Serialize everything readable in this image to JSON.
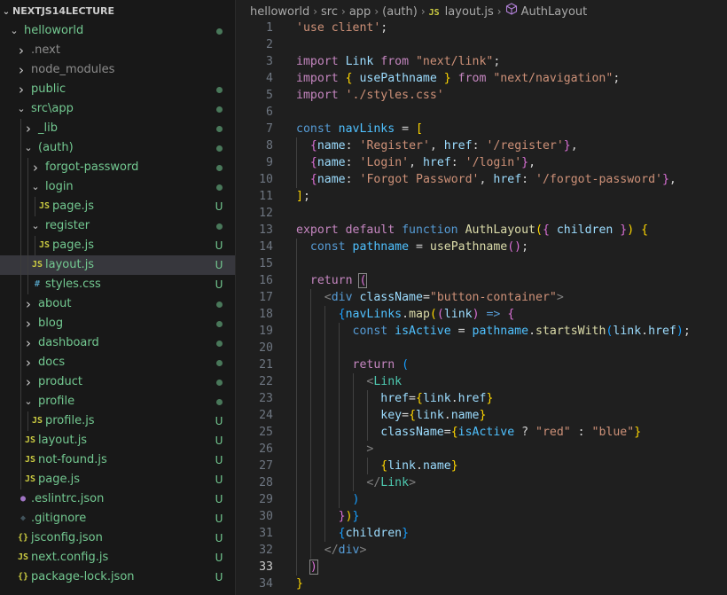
{
  "explorer": {
    "title": "NEXTJS14LECTURE",
    "items": [
      {
        "label": "helloworld",
        "type": "folder",
        "open": true,
        "depth": 0,
        "status": "dot",
        "color": "#73c991"
      },
      {
        "label": ".next",
        "type": "folder",
        "open": false,
        "depth": 1,
        "status": "",
        "color": "#8c8c8c"
      },
      {
        "label": "node_modules",
        "type": "folder",
        "open": false,
        "depth": 1,
        "status": "",
        "color": "#8c8c8c"
      },
      {
        "label": "public",
        "type": "folder",
        "open": false,
        "depth": 1,
        "status": "dot",
        "color": "#73c991"
      },
      {
        "label": "src\\app",
        "type": "folder",
        "open": true,
        "depth": 1,
        "status": "dot",
        "color": "#73c991"
      },
      {
        "label": "_lib",
        "type": "folder",
        "open": false,
        "depth": 2,
        "status": "dot",
        "color": "#73c991"
      },
      {
        "label": "(auth)",
        "type": "folder",
        "open": true,
        "depth": 2,
        "status": "dot",
        "color": "#73c991"
      },
      {
        "label": "forgot-password",
        "type": "folder",
        "open": false,
        "depth": 3,
        "status": "dot",
        "color": "#73c991"
      },
      {
        "label": "login",
        "type": "folder",
        "open": true,
        "depth": 3,
        "status": "dot",
        "color": "#73c991"
      },
      {
        "label": "page.js",
        "type": "js",
        "depth": 4,
        "status": "U",
        "color": "#73c991"
      },
      {
        "label": "register",
        "type": "folder",
        "open": true,
        "depth": 3,
        "status": "dot",
        "color": "#73c991"
      },
      {
        "label": "page.js",
        "type": "js",
        "depth": 4,
        "status": "U",
        "color": "#73c991"
      },
      {
        "label": "layout.js",
        "type": "js",
        "depth": 3,
        "status": "U",
        "color": "#73c991",
        "selected": true
      },
      {
        "label": "styles.css",
        "type": "css",
        "depth": 3,
        "status": "U",
        "color": "#73c991"
      },
      {
        "label": "about",
        "type": "folder",
        "open": false,
        "depth": 2,
        "status": "dot",
        "color": "#73c991"
      },
      {
        "label": "blog",
        "type": "folder",
        "open": false,
        "depth": 2,
        "status": "dot",
        "color": "#73c991"
      },
      {
        "label": "dashboard",
        "type": "folder",
        "open": false,
        "depth": 2,
        "status": "dot",
        "color": "#73c991"
      },
      {
        "label": "docs",
        "type": "folder",
        "open": false,
        "depth": 2,
        "status": "dot",
        "color": "#73c991"
      },
      {
        "label": "product",
        "type": "folder",
        "open": false,
        "depth": 2,
        "status": "dot",
        "color": "#73c991"
      },
      {
        "label": "profile",
        "type": "folder",
        "open": true,
        "depth": 2,
        "status": "dot",
        "color": "#73c991"
      },
      {
        "label": "profile.js",
        "type": "js",
        "depth": 3,
        "status": "U",
        "color": "#73c991"
      },
      {
        "label": "layout.js",
        "type": "js",
        "depth": 2,
        "status": "U",
        "color": "#73c991"
      },
      {
        "label": "not-found.js",
        "type": "js",
        "depth": 2,
        "status": "U",
        "color": "#73c991"
      },
      {
        "label": "page.js",
        "type": "js",
        "depth": 2,
        "status": "U",
        "color": "#73c991"
      },
      {
        "label": ".eslintrc.json",
        "type": "eslint",
        "depth": 1,
        "status": "U",
        "color": "#73c991"
      },
      {
        "label": ".gitignore",
        "type": "git",
        "depth": 1,
        "status": "U",
        "color": "#73c991"
      },
      {
        "label": "jsconfig.json",
        "type": "json",
        "depth": 1,
        "status": "U",
        "color": "#73c991"
      },
      {
        "label": "next.config.js",
        "type": "js",
        "depth": 1,
        "status": "U",
        "color": "#73c991"
      },
      {
        "label": "package-lock.json",
        "type": "json",
        "depth": 1,
        "status": "U",
        "color": "#73c991"
      }
    ],
    "icon_glyphs": {
      "js": "JS",
      "css": "#",
      "json": "{}",
      "git": "◆",
      "eslint": "●"
    },
    "icon_colors": {
      "js": "#cbcb41",
      "css": "#519aba",
      "json": "#cbcb41",
      "git": "#41535b",
      "eslint": "#a074c4"
    }
  },
  "breadcrumb": {
    "parts": [
      "helloworld",
      "src",
      "app",
      "(auth)"
    ],
    "file_badge": "JS",
    "file": "layout.js",
    "symbol_icon": "cube-icon",
    "symbol": "AuthLayout"
  },
  "editor": {
    "current_line": 33,
    "colors": {
      "str": "#ce9178",
      "kw": "#569cd6",
      "ctl": "#c586c0",
      "fn": "#dcdcaa",
      "var": "#9cdcfe",
      "var2": "#4fc1ff",
      "tag": "#4ec9b0",
      "plain": "#d4d4d4",
      "attr": "#9cdcfe",
      "br1": "#ffd700",
      "br2": "#da70d6",
      "br3": "#179fff",
      "punc": "#d4d4d4",
      "jsxtag": "#808080",
      "tagname": "#569cd6"
    },
    "lines": [
      {
        "n": "1",
        "i": 0,
        "t": [
          [
            "str",
            "'use client'"
          ],
          [
            "plain",
            ";"
          ]
        ]
      },
      {
        "n": "2",
        "i": 0,
        "t": []
      },
      {
        "n": "3",
        "i": 0,
        "t": [
          [
            "ctl",
            "import "
          ],
          [
            "var",
            "Link "
          ],
          [
            "ctl",
            "from "
          ],
          [
            "str",
            "\"next/link\""
          ],
          [
            "plain",
            ";"
          ]
        ]
      },
      {
        "n": "4",
        "i": 0,
        "t": [
          [
            "ctl",
            "import "
          ],
          [
            "br1",
            "{ "
          ],
          [
            "var",
            "usePathname "
          ],
          [
            "br1",
            "} "
          ],
          [
            "ctl",
            "from "
          ],
          [
            "str",
            "\"next/navigation\""
          ],
          [
            "plain",
            ";"
          ]
        ]
      },
      {
        "n": "5",
        "i": 0,
        "t": [
          [
            "ctl",
            "import "
          ],
          [
            "str",
            "'./styles.css'"
          ]
        ]
      },
      {
        "n": "6",
        "i": 0,
        "t": []
      },
      {
        "n": "7",
        "i": 0,
        "t": [
          [
            "kw",
            "const "
          ],
          [
            "var2",
            "navLinks "
          ],
          [
            "plain",
            "= "
          ],
          [
            "br1",
            "["
          ]
        ]
      },
      {
        "n": "8",
        "i": 1,
        "t": [
          [
            "plain",
            "  "
          ],
          [
            "br2",
            "{"
          ],
          [
            "var",
            "name"
          ],
          [
            "plain",
            ": "
          ],
          [
            "str",
            "'Register'"
          ],
          [
            "plain",
            ", "
          ],
          [
            "var",
            "href"
          ],
          [
            "plain",
            ": "
          ],
          [
            "str",
            "'/register'"
          ],
          [
            "br2",
            "}"
          ],
          [
            "plain",
            ","
          ]
        ]
      },
      {
        "n": "9",
        "i": 1,
        "t": [
          [
            "plain",
            "  "
          ],
          [
            "br2",
            "{"
          ],
          [
            "var",
            "name"
          ],
          [
            "plain",
            ": "
          ],
          [
            "str",
            "'Login'"
          ],
          [
            "plain",
            ", "
          ],
          [
            "var",
            "href"
          ],
          [
            "plain",
            ": "
          ],
          [
            "str",
            "'/login'"
          ],
          [
            "br2",
            "}"
          ],
          [
            "plain",
            ","
          ]
        ]
      },
      {
        "n": "10",
        "i": 1,
        "t": [
          [
            "plain",
            "  "
          ],
          [
            "br2",
            "{"
          ],
          [
            "var",
            "name"
          ],
          [
            "plain",
            ": "
          ],
          [
            "str",
            "'Forgot Password'"
          ],
          [
            "plain",
            ", "
          ],
          [
            "var",
            "href"
          ],
          [
            "plain",
            ": "
          ],
          [
            "str",
            "'/forgot-password'"
          ],
          [
            "br2",
            "}"
          ],
          [
            "plain",
            ","
          ]
        ]
      },
      {
        "n": "11",
        "i": 0,
        "t": [
          [
            "br1",
            "]"
          ],
          [
            "plain",
            ";"
          ]
        ]
      },
      {
        "n": "12",
        "i": 0,
        "t": []
      },
      {
        "n": "13",
        "i": 0,
        "t": [
          [
            "ctl",
            "export "
          ],
          [
            "ctl",
            "default "
          ],
          [
            "kw",
            "function "
          ],
          [
            "fn",
            "AuthLayout"
          ],
          [
            "br1",
            "("
          ],
          [
            "br2",
            "{ "
          ],
          [
            "var",
            "children "
          ],
          [
            "br2",
            "}"
          ],
          [
            "br1",
            ") "
          ],
          [
            "br1",
            "{"
          ]
        ]
      },
      {
        "n": "14",
        "i": 1,
        "t": [
          [
            "plain",
            "  "
          ],
          [
            "kw",
            "const "
          ],
          [
            "var2",
            "pathname "
          ],
          [
            "plain",
            "= "
          ],
          [
            "fn",
            "usePathname"
          ],
          [
            "br2",
            "()"
          ],
          [
            "plain",
            ";"
          ]
        ]
      },
      {
        "n": "15",
        "i": 1,
        "t": []
      },
      {
        "n": "16",
        "i": 1,
        "t": [
          [
            "plain",
            "  "
          ],
          [
            "ctl",
            "return "
          ],
          [
            "br2",
            "("
          ]
        ]
      },
      {
        "n": "17",
        "i": 2,
        "t": [
          [
            "plain",
            "    "
          ],
          [
            "jsxtag",
            "<"
          ],
          [
            "tagname",
            "div "
          ],
          [
            "attr",
            "className"
          ],
          [
            "plain",
            "="
          ],
          [
            "str",
            "\"button-container\""
          ],
          [
            "jsxtag",
            ">"
          ]
        ]
      },
      {
        "n": "18",
        "i": 3,
        "t": [
          [
            "plain",
            "      "
          ],
          [
            "br3",
            "{"
          ],
          [
            "var2",
            "navLinks"
          ],
          [
            "plain",
            "."
          ],
          [
            "fn",
            "map"
          ],
          [
            "br1",
            "("
          ],
          [
            "br2",
            "("
          ],
          [
            "var",
            "link"
          ],
          [
            "br2",
            ")"
          ],
          [
            "plain",
            " "
          ],
          [
            "kw",
            "=>"
          ],
          [
            "plain",
            " "
          ],
          [
            "br2",
            "{"
          ]
        ]
      },
      {
        "n": "19",
        "i": 4,
        "t": [
          [
            "plain",
            "        "
          ],
          [
            "kw",
            "const "
          ],
          [
            "var2",
            "isActive "
          ],
          [
            "plain",
            "= "
          ],
          [
            "var2",
            "pathname"
          ],
          [
            "plain",
            "."
          ],
          [
            "fn",
            "startsWith"
          ],
          [
            "br3",
            "("
          ],
          [
            "var",
            "link"
          ],
          [
            "plain",
            "."
          ],
          [
            "var",
            "href"
          ],
          [
            "br3",
            ")"
          ],
          [
            "plain",
            ";"
          ]
        ]
      },
      {
        "n": "20",
        "i": 4,
        "t": []
      },
      {
        "n": "21",
        "i": 4,
        "t": [
          [
            "plain",
            "        "
          ],
          [
            "ctl",
            "return "
          ],
          [
            "br3",
            "("
          ]
        ]
      },
      {
        "n": "22",
        "i": 5,
        "t": [
          [
            "plain",
            "          "
          ],
          [
            "jsxtag",
            "<"
          ],
          [
            "tag",
            "Link"
          ]
        ]
      },
      {
        "n": "23",
        "i": 6,
        "t": [
          [
            "plain",
            "            "
          ],
          [
            "attr",
            "href"
          ],
          [
            "plain",
            "="
          ],
          [
            "br1",
            "{"
          ],
          [
            "var",
            "link"
          ],
          [
            "plain",
            "."
          ],
          [
            "var",
            "href"
          ],
          [
            "br1",
            "}"
          ]
        ]
      },
      {
        "n": "24",
        "i": 6,
        "t": [
          [
            "plain",
            "            "
          ],
          [
            "attr",
            "key"
          ],
          [
            "plain",
            "="
          ],
          [
            "br1",
            "{"
          ],
          [
            "var",
            "link"
          ],
          [
            "plain",
            "."
          ],
          [
            "var",
            "name"
          ],
          [
            "br1",
            "}"
          ]
        ]
      },
      {
        "n": "25",
        "i": 6,
        "t": [
          [
            "plain",
            "            "
          ],
          [
            "attr",
            "className"
          ],
          [
            "plain",
            "="
          ],
          [
            "br1",
            "{"
          ],
          [
            "var2",
            "isActive "
          ],
          [
            "plain",
            "? "
          ],
          [
            "str",
            "\"red\" "
          ],
          [
            "plain",
            ": "
          ],
          [
            "str",
            "\"blue\""
          ],
          [
            "br1",
            "}"
          ]
        ]
      },
      {
        "n": "26",
        "i": 5,
        "t": [
          [
            "plain",
            "          "
          ],
          [
            "jsxtag",
            ">"
          ]
        ]
      },
      {
        "n": "27",
        "i": 6,
        "t": [
          [
            "plain",
            "            "
          ],
          [
            "br1",
            "{"
          ],
          [
            "var",
            "link"
          ],
          [
            "plain",
            "."
          ],
          [
            "var",
            "name"
          ],
          [
            "br1",
            "}"
          ]
        ]
      },
      {
        "n": "28",
        "i": 5,
        "t": [
          [
            "plain",
            "          "
          ],
          [
            "jsxtag",
            "</"
          ],
          [
            "tag",
            "Link"
          ],
          [
            "jsxtag",
            ">"
          ]
        ]
      },
      {
        "n": "29",
        "i": 4,
        "t": [
          [
            "plain",
            "        "
          ],
          [
            "br3",
            ")"
          ]
        ]
      },
      {
        "n": "30",
        "i": 3,
        "t": [
          [
            "plain",
            "      "
          ],
          [
            "br2",
            "}"
          ],
          [
            "br1",
            ")"
          ],
          [
            "br3",
            "}"
          ]
        ]
      },
      {
        "n": "31",
        "i": 3,
        "t": [
          [
            "plain",
            "      "
          ],
          [
            "br3",
            "{"
          ],
          [
            "var",
            "children"
          ],
          [
            "br3",
            "}"
          ]
        ]
      },
      {
        "n": "32",
        "i": 2,
        "t": [
          [
            "plain",
            "    "
          ],
          [
            "jsxtag",
            "</"
          ],
          [
            "tagname",
            "div"
          ],
          [
            "jsxtag",
            ">"
          ]
        ]
      },
      {
        "n": "33",
        "i": 1,
        "t": [
          [
            "plain",
            "  "
          ],
          [
            "br2",
            ")"
          ]
        ]
      },
      {
        "n": "34",
        "i": 0,
        "t": [
          [
            "br1",
            "}"
          ]
        ]
      }
    ]
  }
}
